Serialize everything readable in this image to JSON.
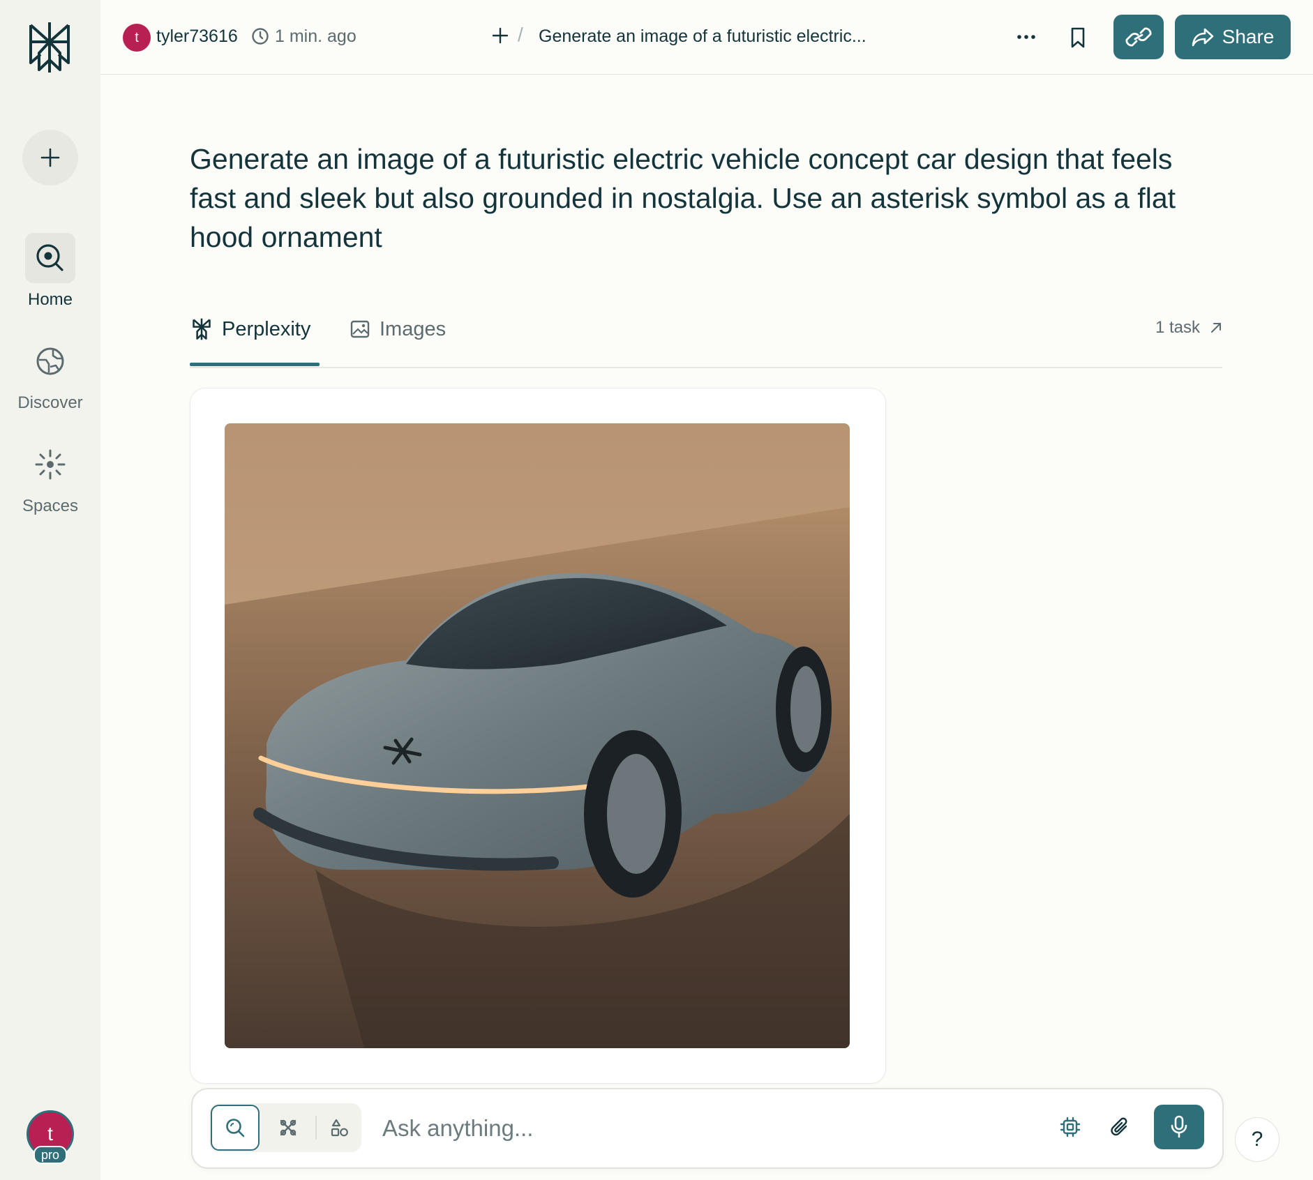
{
  "sidebar": {
    "nav": [
      {
        "label": "Home",
        "icon": "search-icon"
      },
      {
        "label": "Discover",
        "icon": "globe-icon"
      },
      {
        "label": "Spaces",
        "icon": "sparkle-icon"
      }
    ],
    "avatar_initial": "t",
    "plan_badge": "pro"
  },
  "topbar": {
    "user_initial": "t",
    "username": "tyler73616",
    "time_ago": "1 min. ago",
    "separator": "/",
    "thread_title": "Generate an image of a futuristic electric...",
    "share_label": "Share"
  },
  "query": "Generate an image of a futuristic electric vehicle concept car design that feels fast and sleek but also grounded in nostalgia. Use an asterisk symbol as a flat hood ornament",
  "tabs": [
    {
      "label": "Perplexity",
      "icon": "perplexity-logo-icon",
      "active": true
    },
    {
      "label": "Images",
      "icon": "image-icon",
      "active": false
    }
  ],
  "task_link": "1 task",
  "askbar": {
    "placeholder": "Ask anything..."
  },
  "help_label": "?",
  "colors": {
    "accent": "#2e6f7a",
    "avatar": "#b81f52",
    "background": "#fcfcf9",
    "sidebar": "#f3f3ee",
    "text": "#13343b"
  }
}
